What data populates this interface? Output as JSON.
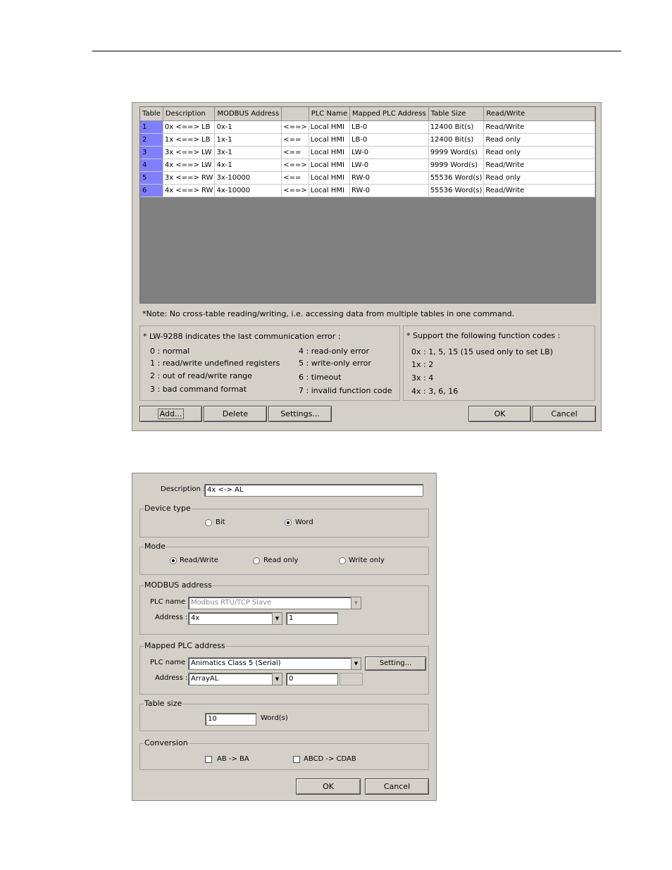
{
  "address_table_dialog": {
    "columns": [
      "Table",
      "Description",
      "MODBUS Address",
      "",
      "PLC Name",
      "Mapped PLC Address",
      "Table Size",
      "Read/Write"
    ],
    "rows": [
      [
        "1",
        "0x <==> LB",
        "0x-1",
        "<==>",
        "Local HMI",
        "LB-0",
        "12400 Bit(s)",
        "Read/Write"
      ],
      [
        "2",
        "1x <==> LB",
        "1x-1",
        "<==",
        "Local HMI",
        "LB-0",
        "12400 Bit(s)",
        "Read only"
      ],
      [
        "3",
        "3x <==> LW",
        "3x-1",
        "<==",
        "Local HMI",
        "LW-0",
        "9999 Word(s)",
        "Read only"
      ],
      [
        "4",
        "4x <==> LW",
        "4x-1",
        "<==>",
        "Local HMI",
        "LW-0",
        "9999 Word(s)",
        "Read/Write"
      ],
      [
        "5",
        "3x <==> RW",
        "3x-10000",
        "<==",
        "Local HMI",
        "RW-0",
        "55536 Word(s)",
        "Read only"
      ],
      [
        "6",
        "4x <==> RW",
        "4x-10000",
        "<==>",
        "Local HMI",
        "RW-0",
        "55536 Word(s)",
        "Read/Write"
      ]
    ],
    "note": "*Note: No cross-table reading/writing, i.e. accessing data from multiple tables in one command.",
    "error_panel": {
      "title": "* LW-9288 indicates the last communication error :",
      "codes_left": [
        "0 : normal",
        "1 : read/write undefined registers",
        "2 : out of read/write range",
        "3 : bad command format"
      ],
      "codes_right": [
        "4 : read-only error",
        "5 : write-only error",
        "6 : timeout",
        "7 : invalid function code"
      ]
    },
    "function_panel": {
      "title": "* Support the following function codes :",
      "codes": [
        "0x : 1, 5, 15 (15 used only to set LB)",
        "1x : 2",
        "3x : 4",
        "4x : 3, 6, 16"
      ]
    },
    "buttons": {
      "add": "Add...",
      "delete": "Delete",
      "settings": "Settings...",
      "ok": "OK",
      "cancel": "Cancel"
    }
  },
  "entry_dialog": {
    "description_label": "Description :",
    "description_value": "4x <-> AL",
    "device_type": {
      "title": "Device type",
      "bit": "Bit",
      "word": "Word",
      "selected": "Word"
    },
    "mode": {
      "title": "Mode",
      "read_write": "Read/Write",
      "read_only": "Read only",
      "write_only": "Write only",
      "selected": "Read/Write"
    },
    "modbus_address": {
      "title": "MODBUS address",
      "plc_name_label": "PLC name :",
      "plc_name_value": "Modbus RTU/TCP Slave",
      "address_label": "Address :",
      "address_type": "4x",
      "address_value": "1"
    },
    "mapped_plc_address": {
      "title": "Mapped PLC address",
      "plc_name_label": "PLC name :",
      "plc_name_value": "Animatics Class 5 (Serial)",
      "setting_button": "Setting...",
      "address_label": "Address :",
      "address_type": "ArrayAL",
      "address_value": "0"
    },
    "table_size": {
      "title": "Table size",
      "value": "10",
      "unit": "Word(s)"
    },
    "conversion": {
      "title": "Conversion",
      "ab_ba": "AB -> BA",
      "abcd_cdab": "ABCD -> CDAB"
    },
    "buttons": {
      "ok": "OK",
      "cancel": "Cancel"
    }
  }
}
